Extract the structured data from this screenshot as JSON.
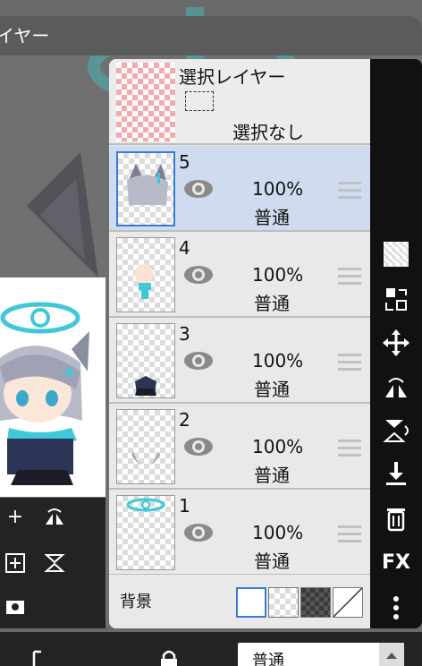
{
  "window": {
    "title": "イヤー"
  },
  "selection_layer": {
    "title": "選択レイヤー",
    "status": "選択なし"
  },
  "layers": [
    {
      "number": "5",
      "opacity": "100%",
      "blend": "普通",
      "selected": true
    },
    {
      "number": "4",
      "opacity": "100%",
      "blend": "普通",
      "selected": false
    },
    {
      "number": "3",
      "opacity": "100%",
      "blend": "普通",
      "selected": false
    },
    {
      "number": "2",
      "opacity": "100%",
      "blend": "普通",
      "selected": false
    },
    {
      "number": "1",
      "opacity": "100%",
      "blend": "普通",
      "selected": false
    }
  ],
  "background": {
    "label": "背景"
  },
  "right_toolbar": {
    "fx_label": "FX"
  },
  "bottom_bar": {
    "blend_mode": "普通"
  },
  "colors": {
    "selected_row": "#cfdcf0",
    "selected_border": "#3a7ad6",
    "halo": "#40c8d8",
    "toolbar_bg": "#111111",
    "panel_bg": "#e6e6e6"
  },
  "icons": [
    "eye-icon",
    "drag-handle-icon",
    "checker-icon",
    "merge-icon",
    "move-icon",
    "rotate-flip-icon",
    "flip-vertical-icon",
    "download-icon",
    "trash-icon",
    "more-icon",
    "plus-icon",
    "add-layer-icon",
    "camera-icon",
    "lock-icon"
  ]
}
